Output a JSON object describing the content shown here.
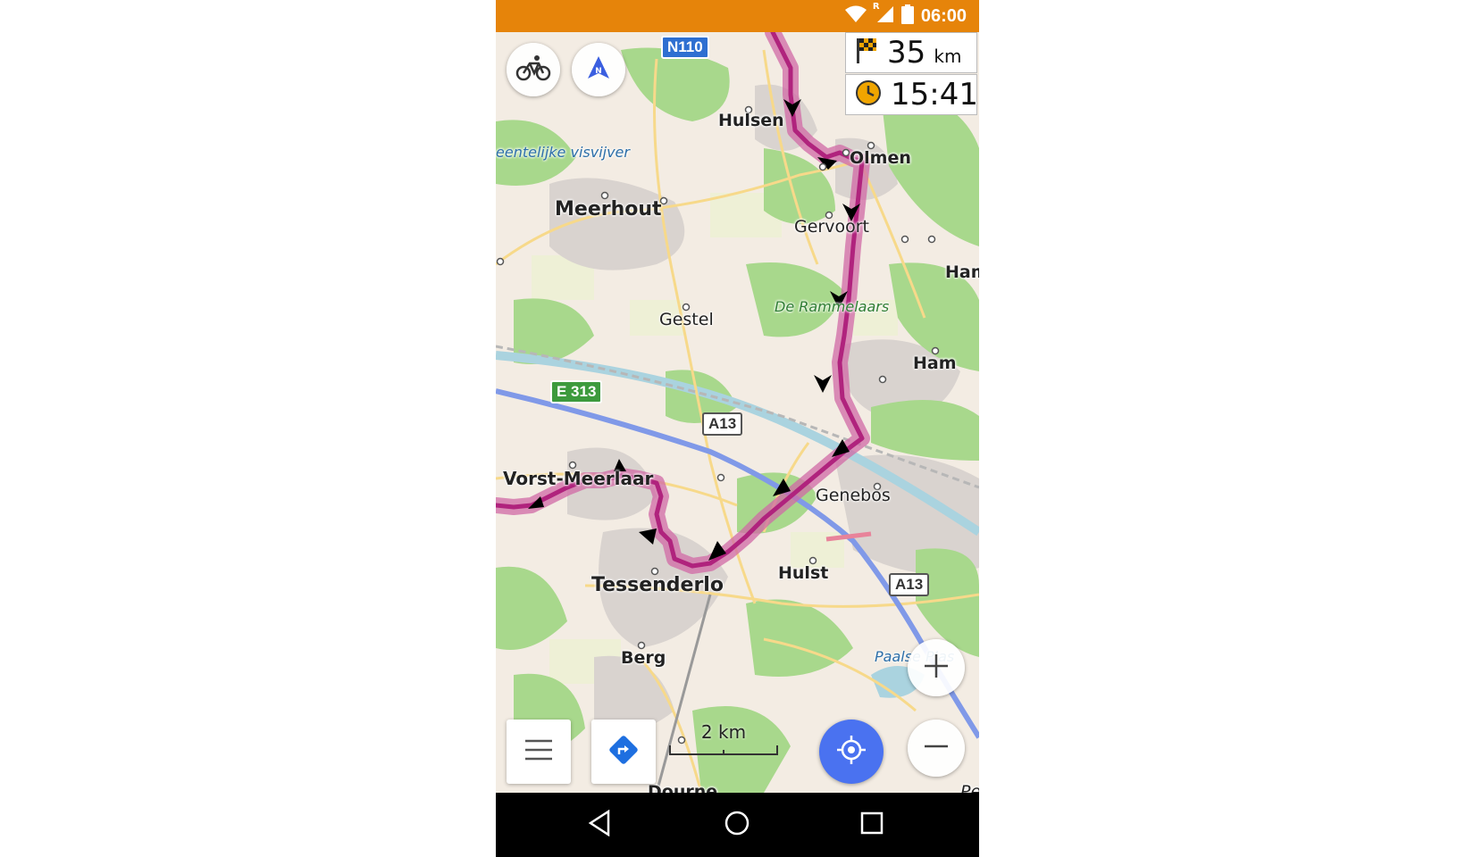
{
  "statusbar": {
    "time": "06:00",
    "roaming": "R",
    "wifi_icon": "wifi-icon",
    "signal_icon": "signal-icon",
    "battery_icon": "battery-icon"
  },
  "map": {
    "places": {
      "hulsen": "Hulsen",
      "olmen": "Olmen",
      "meerhout": "Meerhout",
      "gervoort": "Gervoort",
      "ham_top": "Ham",
      "gestel": "Gestel",
      "ham": "Ham",
      "vorst_meerlaar": "Vorst-Meerlaar",
      "genebos": "Genebos",
      "hulst": "Hulst",
      "tessenderlo": "Tessenderlo",
      "berg": "Berg",
      "dourne": "Dourne",
      "pe": "Pe"
    },
    "water_labels": {
      "visvijver": "eentelijke visvijver",
      "paalse_plas": "Paalse Plas"
    },
    "wood_labels": {
      "rammelaars": "De Rammelaars"
    },
    "shields": {
      "n110": "N110",
      "e313": "E 313",
      "a13_mid": "A13",
      "a13_right": "A13"
    }
  },
  "widgets": {
    "distance": {
      "value": "35",
      "unit": "km",
      "icon": "checkered-flag-icon"
    },
    "arrival_time": {
      "value": "15:41",
      "icon": "clock-icon"
    },
    "scale": {
      "label": "2 km"
    }
  },
  "buttons": {
    "profile": "bicycle-icon",
    "compass": "compass-north-icon",
    "zoom_in": "plus-icon",
    "zoom_out": "minus-icon",
    "menu": "hamburger-menu-icon",
    "directions": "directions-icon",
    "my_location": "crosshair-location-icon"
  },
  "colors": {
    "statusbar": "#e6840a",
    "route": "#b0237d",
    "route_halo": "#d06aa5",
    "location_button": "#4a72f0",
    "directions_icon": "#1e6fe0"
  },
  "navbar": {
    "back": "back-triangle-icon",
    "home": "home-circle-icon",
    "recents": "recents-square-icon"
  }
}
